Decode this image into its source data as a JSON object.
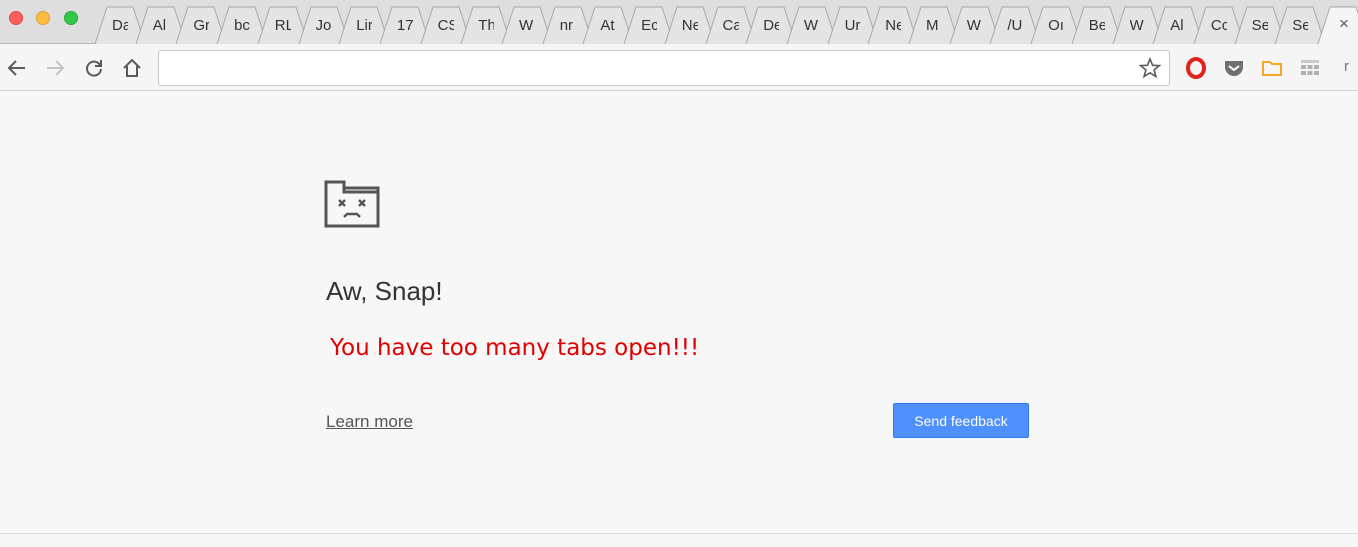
{
  "tabs": [
    "Da",
    "Al",
    "Gr",
    "bc",
    "RL",
    "Jo",
    "Lir",
    "17",
    "CS",
    "Th",
    "W",
    "nr",
    "At",
    "Ec",
    "Ne",
    "Ca",
    "De",
    "W",
    "Ur",
    "Ne",
    "M",
    "W",
    "/U",
    "Oı",
    "Be",
    "W",
    "Al",
    "Cc",
    "Se",
    "Se"
  ],
  "active_tab": {
    "close": "×"
  },
  "toolbar": {
    "url": "",
    "url_placeholder": "",
    "ext_label": "r"
  },
  "error": {
    "title": "Aw, Snap!",
    "message": "You have too many tabs open!!!",
    "learn_more": "Learn more",
    "send_feedback": "Send feedback"
  },
  "colors": {
    "accent": "#4d90fe",
    "message": "#e00000",
    "opera": "#e0211c",
    "pocket": "#707070",
    "folder": "#f5a623"
  },
  "icons": {
    "back": "arrow-left-icon",
    "forward": "arrow-right-icon",
    "reload": "reload-icon",
    "home": "home-icon",
    "bookmark": "star-icon",
    "sad": "sad-folder-icon"
  }
}
